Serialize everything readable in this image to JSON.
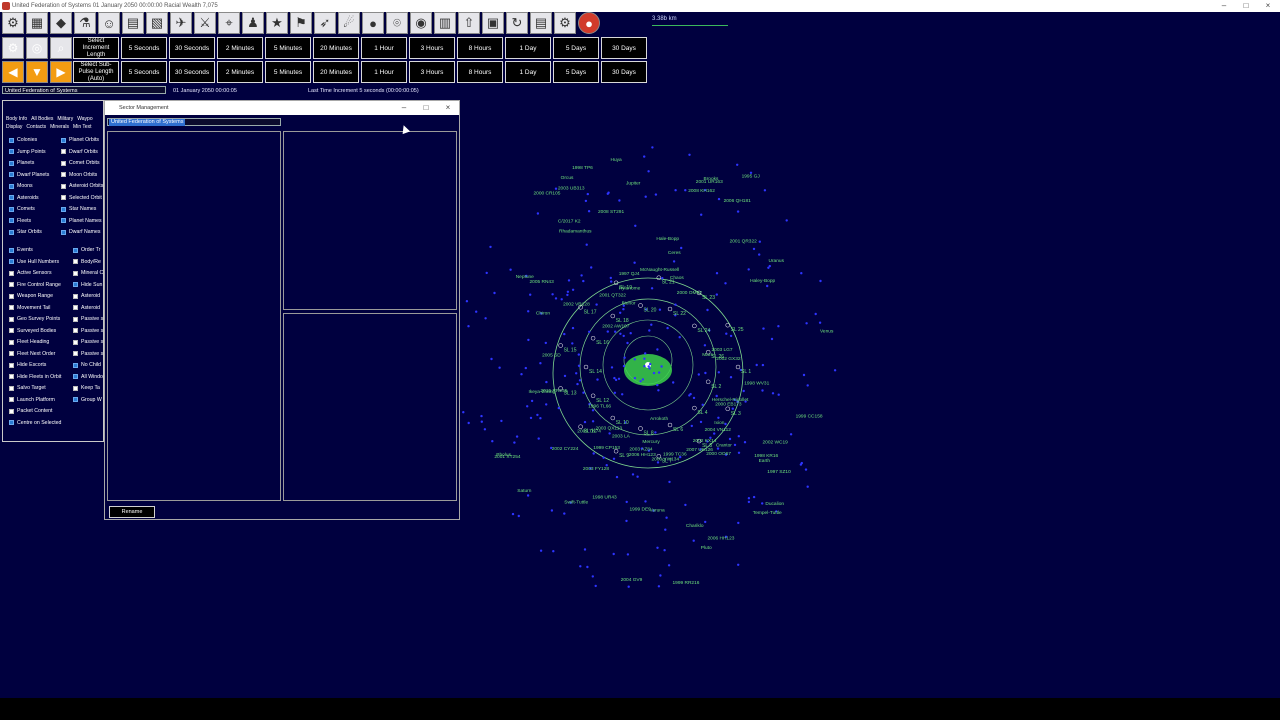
{
  "window": {
    "title": "United Federation of Systems   01 January 2050 00:00:00   Racial Wealth 7,075"
  },
  "toolbar": {
    "icons": [
      "gear-icon",
      "factory-icon",
      "treasure-icon",
      "flask-icon",
      "people-icon",
      "mineral-icon",
      "image-icon",
      "ship-icon",
      "sword-icon",
      "telescope-icon",
      "officer-icon",
      "medal-icon",
      "flag-icon",
      "missile-icon",
      "comet-icon",
      "planet-icon",
      "dish-icon",
      "blackhole-icon",
      "stats-icon",
      "rocket-icon",
      "calendar-icon",
      "refresh-icon",
      "document-icon",
      "settings-icon",
      "stop-icon"
    ],
    "distance": "3.38b km",
    "increment_label": "Select Increment Length",
    "subpulse_label": "Select Sub-Pulse Length (Auto)",
    "increments": [
      "5 Seconds",
      "30 Seconds",
      "2 Minutes",
      "5 Minutes",
      "20 Minutes",
      "1 Hour",
      "3 Hours",
      "8 Hours",
      "1 Day",
      "5 Days",
      "30 Days"
    ]
  },
  "status": {
    "race": "United Federation of Systems",
    "date": "01 January 2050 00:00:05",
    "last_increment": "Last Time Increment 5 seconds (00:00:00:05)"
  },
  "left_panel": {
    "tabs_row1": [
      "Body Info",
      "All Bodies",
      "Military",
      "Waypo"
    ],
    "tabs_row2": [
      "Display",
      "Contacts",
      "Minerals",
      "Min Text"
    ],
    "checks_col1": [
      {
        "label": "Colonies",
        "on": true
      },
      {
        "label": "Jump Points",
        "on": true
      },
      {
        "label": "Planets",
        "on": true
      },
      {
        "label": "Dwarf Planets",
        "on": true
      },
      {
        "label": "Moons",
        "on": true
      },
      {
        "label": "Asteroids",
        "on": true
      },
      {
        "label": "Comets",
        "on": true
      },
      {
        "label": "Fleets",
        "on": true
      },
      {
        "label": "Star Orbits",
        "on": true
      }
    ],
    "checks_col2": [
      {
        "label": "Planet Orbits",
        "on": true
      },
      {
        "label": "Dwarf Orbits",
        "on": false
      },
      {
        "label": "Comet Orbits",
        "on": false
      },
      {
        "label": "Moon Orbits",
        "on": false
      },
      {
        "label": "Asteroid Orbits",
        "on": false
      },
      {
        "label": "Selected Orbit",
        "on": false
      },
      {
        "label": "Star Names",
        "on": true
      },
      {
        "label": "Planet Names",
        "on": true
      },
      {
        "label": "Dwarf Names",
        "on": true
      }
    ],
    "checks_col3": [
      {
        "label": "Events",
        "on": true
      },
      {
        "label": "Use Hull Numbers",
        "on": true
      },
      {
        "label": "Active Sensors",
        "on": false
      },
      {
        "label": "Fire Control Range",
        "on": false
      },
      {
        "label": "Weapon Range",
        "on": false
      },
      {
        "label": "Movement Tail",
        "on": false
      },
      {
        "label": "Geo Survey Points",
        "on": false
      },
      {
        "label": "Surveyed Bodies",
        "on": false
      },
      {
        "label": "Fleet Heading",
        "on": false
      },
      {
        "label": "Fleet Next Order",
        "on": false
      },
      {
        "label": "Hide Escorts",
        "on": false
      },
      {
        "label": "Hide Fleets in Orbit",
        "on": false
      },
      {
        "label": "Salvo Target",
        "on": false
      },
      {
        "label": "Launch Platform",
        "on": false
      },
      {
        "label": "Packet Content",
        "on": false
      },
      {
        "label": "Centre on Selected",
        "on": true
      }
    ],
    "checks_col4": [
      {
        "label": "Order Tr",
        "on": true
      },
      {
        "label": "Body/Re",
        "on": false
      },
      {
        "label": "Mineral C",
        "on": false
      },
      {
        "label": "Hide Sun",
        "on": true
      },
      {
        "label": "Asteroid",
        "on": false
      },
      {
        "label": "Asteroid",
        "on": false
      },
      {
        "label": "Passive s",
        "on": false
      },
      {
        "label": "Passive s",
        "on": false
      },
      {
        "label": "Passive s",
        "on": false
      },
      {
        "label": "Passive s",
        "on": false
      },
      {
        "label": "No Child",
        "on": true
      },
      {
        "label": "All Windo",
        "on": true
      },
      {
        "label": "Keep Ta",
        "on": false
      },
      {
        "label": "Group W",
        "on": true
      }
    ]
  },
  "dialog": {
    "title": "Sector Management",
    "selected": "United Federation of Systems",
    "rename_label": "Rename"
  },
  "map": {
    "sectors": [
      "SL 1",
      "SL 2",
      "SL 3",
      "SL 4",
      "SL 5",
      "SL 6",
      "SL 7",
      "SL 8",
      "SL 9",
      "SL 10",
      "SL 11",
      "SL 12",
      "SL 13",
      "SL 14",
      "SL 15",
      "SL 16",
      "SL 17",
      "SL 18",
      "SL 19",
      "SL 20",
      "SL 21",
      "SL 22",
      "SL 23",
      "SL 24",
      "SL 25",
      "SL 26"
    ],
    "bodies": [
      "2006 QH181",
      "2008 ST291",
      "1999 CC158",
      "2002 GX32",
      "2015 RR245",
      "2003 QX113",
      "1999 CP153",
      "2000 YW134",
      "2002 KX14",
      "1999 DE9",
      "2003 LA",
      "1997 QJ4",
      "2000 EB173",
      "1998 KR16",
      "1998 UR43",
      "2002 WC19",
      "1995 GJ",
      "2002 CY224",
      "2001 QT322",
      "Haley-Bopp",
      "Varuna",
      "Herschel-Rigollet",
      "Rhadamanthus",
      "Pluto",
      "Huya",
      "Swift-Tuttle",
      "Neptune",
      "Uranus",
      "Saturn",
      "Jupiter",
      "Mars",
      "Earth",
      "Venus",
      "Mercury",
      "Ceres",
      "Orcus",
      "Ixion",
      "Chaos",
      "Ducalion",
      "Brooks",
      "Ikeya-Zhang",
      "Hylonome",
      "McNaught-Russell",
      "Tempel-Tuttle",
      "Bienor",
      "Chariklo",
      "Crantor",
      "Pholus",
      "Chiron",
      "Hale-Bopp",
      "2003 AZ84",
      "2004 VN112",
      "2005 TN74",
      "2002 AW197",
      "1999 RR216",
      "2003 FY128",
      "2003 UB313",
      "1999 TC36",
      "2003 LG7",
      "2000 OM67",
      "1996 TL66",
      "2005 RN43",
      "2001 XT254",
      "2007 UK126",
      "2005 SD",
      "2001 UR163",
      "2008 KH162",
      "1997 SZ10",
      "2004 GV9",
      "2000 CR105",
      "1998 TP6",
      "2006 HH123",
      "1998 WV31",
      "2002 VR128",
      "2001 QR322",
      "2006 HH123",
      "2000 OO67",
      "C/2017 K2"
    ],
    "annotation_labels": [
      "Arrokoth"
    ]
  }
}
